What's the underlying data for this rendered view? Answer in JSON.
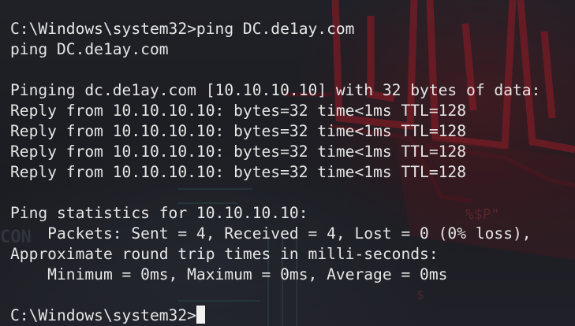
{
  "terminal": {
    "lines": [
      "C:\\Windows\\system32>ping DC.de1ay.com",
      "ping DC.de1ay.com",
      "",
      "Pinging dc.de1ay.com [10.10.10.10] with 32 bytes of data:",
      "Reply from 10.10.10.10: bytes=32 time<1ms TTL=128",
      "Reply from 10.10.10.10: bytes=32 time<1ms TTL=128",
      "Reply from 10.10.10.10: bytes=32 time<1ms TTL=128",
      "Reply from 10.10.10.10: bytes=32 time<1ms TTL=128",
      "",
      "Ping statistics for 10.10.10.10:",
      "    Packets: Sent = 4, Received = 4, Lost = 0 (0% loss),",
      "Approximate round trip times in milli-seconds:",
      "    Minimum = 0ms, Maximum = 0ms, Average = 0ms",
      ""
    ],
    "prompt": "C:\\Windows\\system32>"
  },
  "wallpaper": {
    "accent_color": "#8a1f28",
    "text_fragments": [
      "CON",
      "%$P\"",
      "$"
    ]
  }
}
